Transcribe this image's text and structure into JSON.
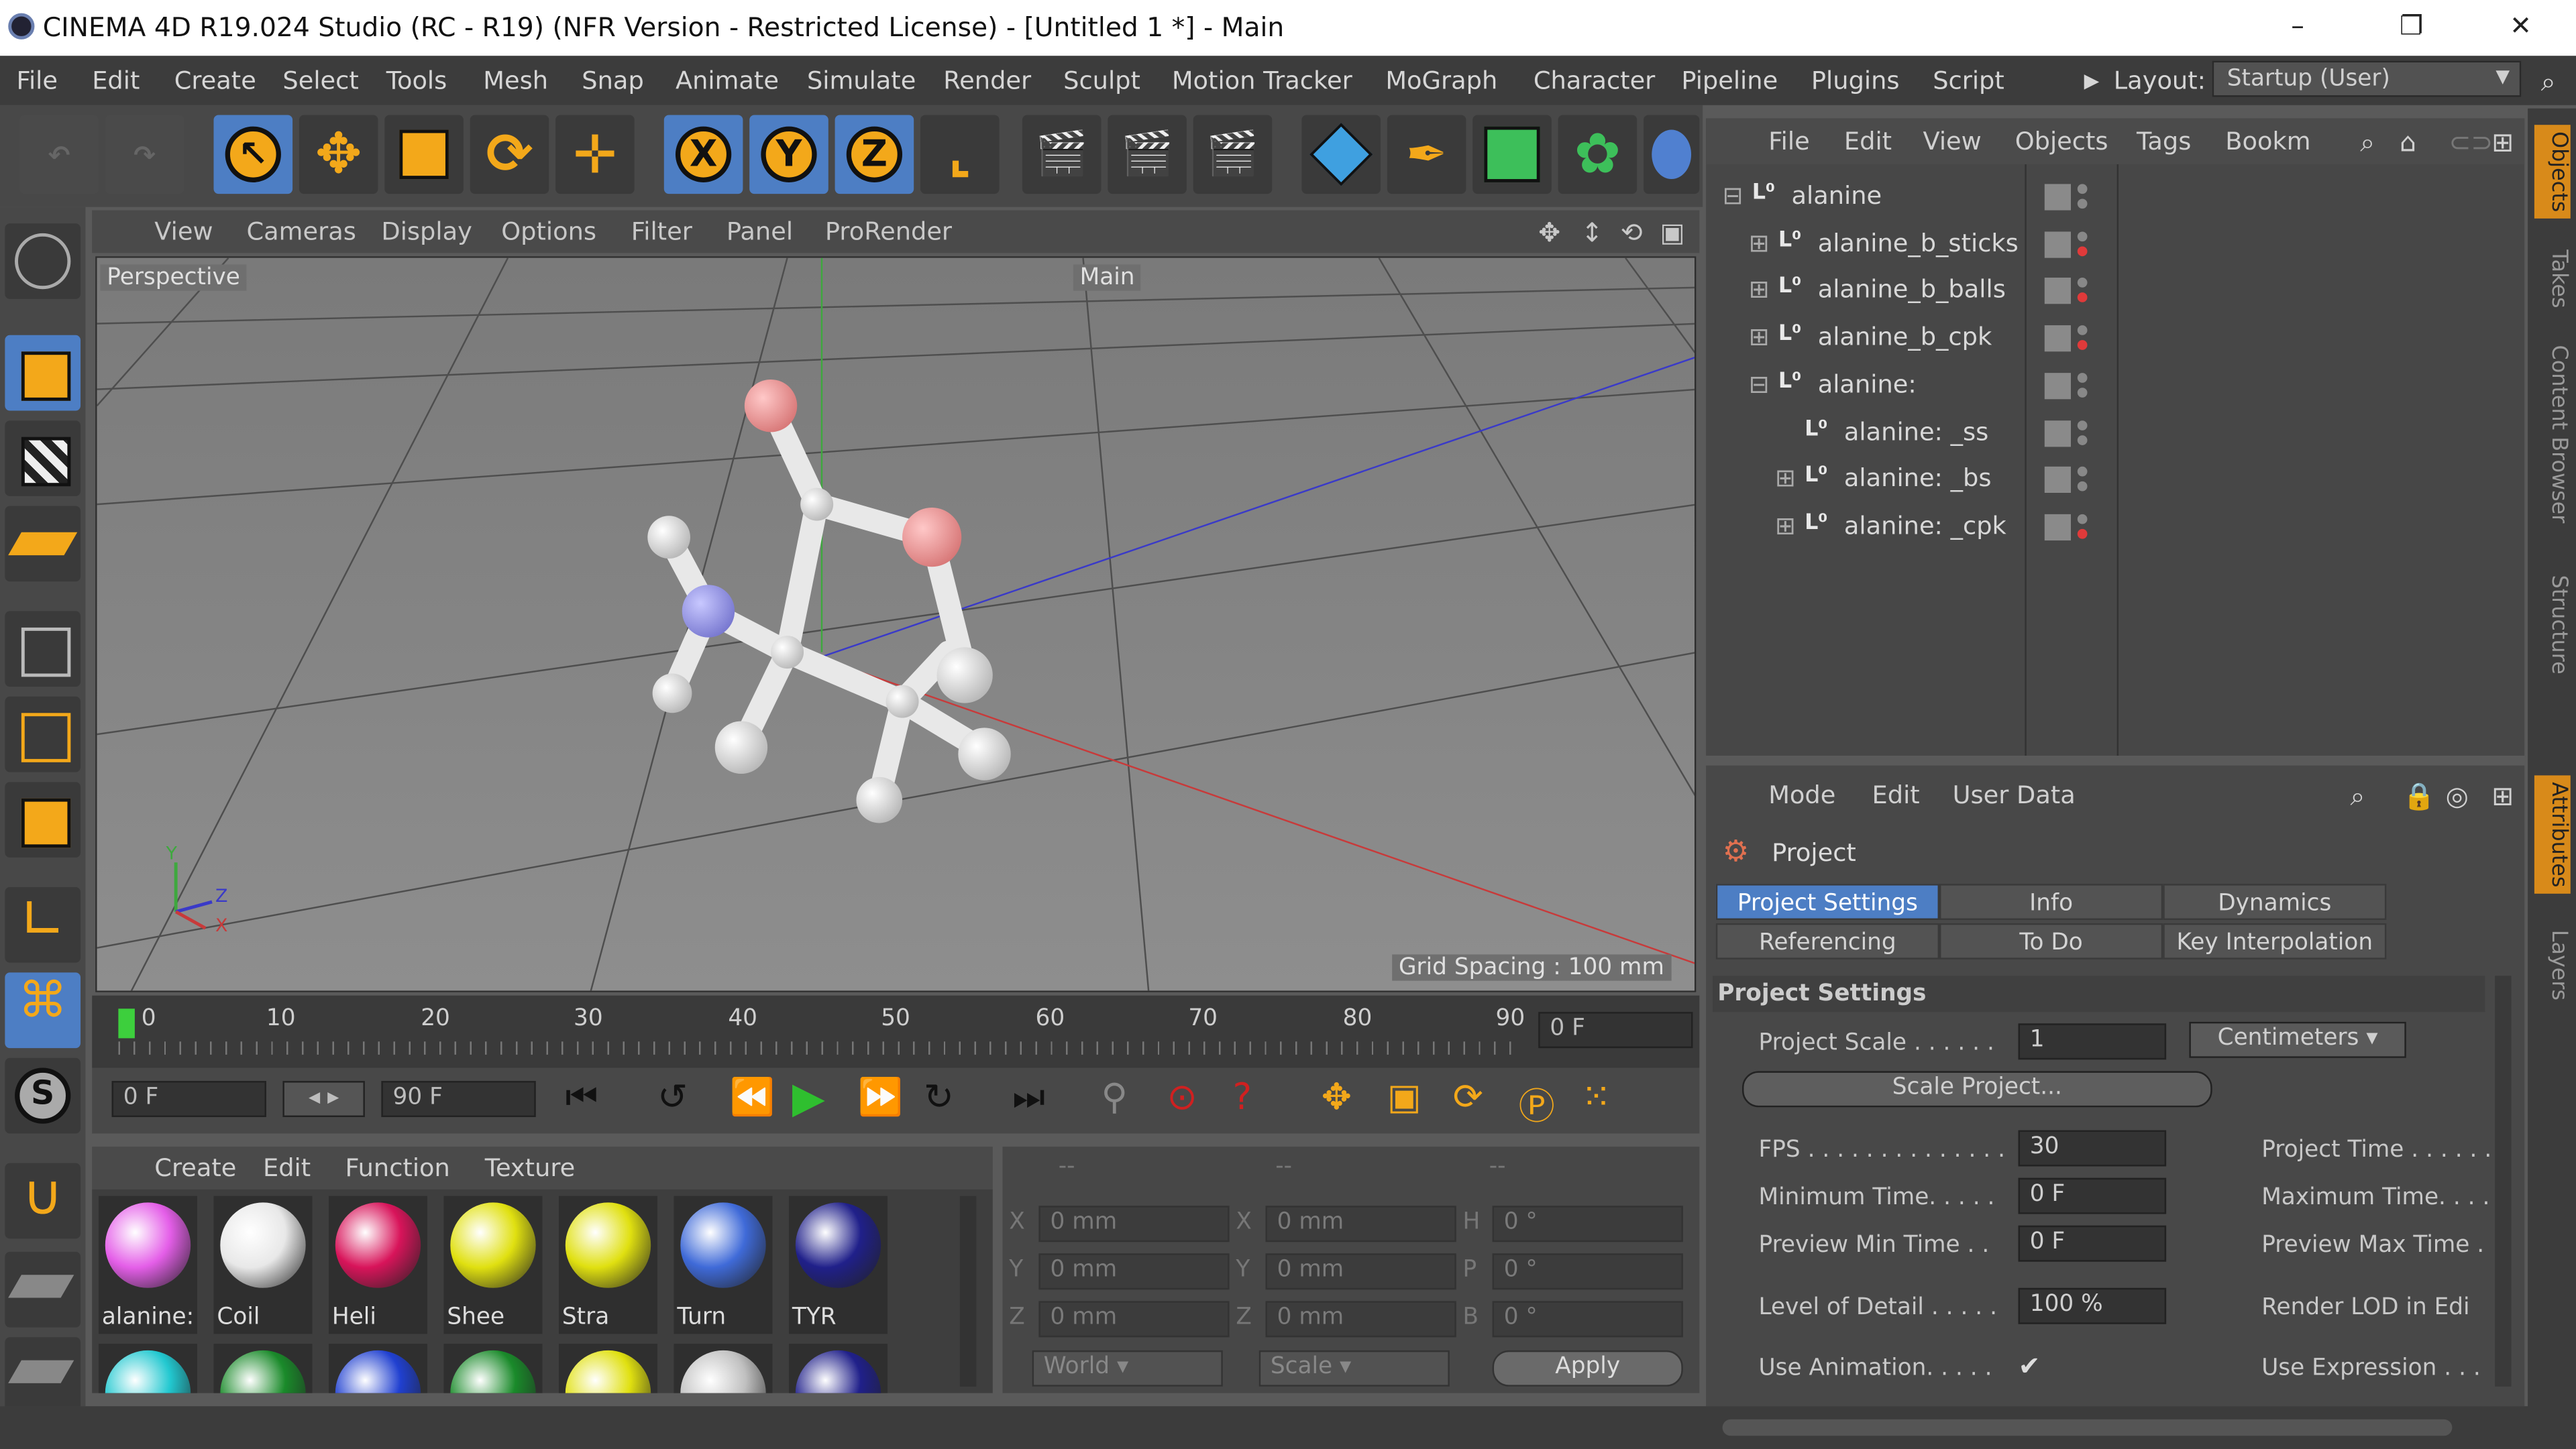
{
  "window": {
    "title": "CINEMA 4D R19.024 Studio (RC - R19) (NFR Version - Restricted License) - [Untitled 1 *] - Main",
    "controls": [
      "–",
      "❐",
      "✕"
    ]
  },
  "menubar": {
    "items": [
      "File",
      "Edit",
      "Create",
      "Select",
      "Tools",
      "Mesh",
      "Snap",
      "Animate",
      "Simulate",
      "Render",
      "Sculpt",
      "Motion Tracker",
      "MoGraph",
      "Character",
      "Pipeline",
      "Plugins",
      "Script"
    ],
    "layout_label": "Layout:",
    "layout_value": "Startup (User)"
  },
  "toolbar": {
    "axis_x": "X",
    "axis_y": "Y",
    "axis_z": "Z"
  },
  "viewport": {
    "menu": [
      "View",
      "Cameras",
      "Display",
      "Options",
      "Filter",
      "Panel",
      "ProRender"
    ],
    "camera_label": "Perspective",
    "main_label": "Main",
    "grid_spacing": "Grid Spacing : 100 mm",
    "axis_y": "Y",
    "axis_z": "Z",
    "axis_x": "X"
  },
  "timeline": {
    "ticks": [
      "0",
      "10",
      "20",
      "30",
      "40",
      "50",
      "60",
      "70",
      "80",
      "90"
    ],
    "current_frame": "0 F",
    "start_frame": "0 F",
    "end_frame": "90 F"
  },
  "material_manager": {
    "menu": [
      "Create",
      "Edit",
      "Function",
      "Texture"
    ],
    "materials": [
      {
        "label": "alanine:",
        "color": "#e45ee8"
      },
      {
        "label": "Coil",
        "color": "#e8e8e8"
      },
      {
        "label": "Heli",
        "color": "#d8145a"
      },
      {
        "label": "Shee",
        "color": "#e0e010"
      },
      {
        "label": "Stra",
        "color": "#e0e010"
      },
      {
        "label": "Turn",
        "color": "#3f6ad8"
      },
      {
        "label": "TYR",
        "color": "#20208a"
      }
    ],
    "second_row_colors": [
      "#22c8d0",
      "#1a8a2a",
      "#2040d0",
      "#1a8a2a",
      "#e0e010",
      "#c0c0c0",
      "#20208a"
    ]
  },
  "coordinates": {
    "headers": [
      "--",
      "--",
      "--"
    ],
    "rows": [
      {
        "l1": "X",
        "v1": "0 mm",
        "l2": "X",
        "v2": "0 mm",
        "l3": "H",
        "v3": "0 °"
      },
      {
        "l1": "Y",
        "v1": "0 mm",
        "l2": "Y",
        "v2": "0 mm",
        "l3": "P",
        "v3": "0 °"
      },
      {
        "l1": "Z",
        "v1": "0 mm",
        "l2": "Z",
        "v2": "0 mm",
        "l3": "B",
        "v3": "0 °"
      }
    ],
    "mode_world": "World",
    "mode_scale": "Scale",
    "apply": "Apply"
  },
  "object_manager": {
    "menu": [
      "File",
      "Edit",
      "View",
      "Objects",
      "Tags",
      "Bookm"
    ],
    "objects": [
      {
        "name": "alanine",
        "expander": "⊟"
      },
      {
        "name": "alanine_b_sticks",
        "expander": "⊞"
      },
      {
        "name": "alanine_b_balls",
        "expander": "⊞"
      },
      {
        "name": "alanine_b_cpk",
        "expander": "⊞"
      },
      {
        "name": "alanine:",
        "expander": "⊟"
      },
      {
        "name": "alanine: _ss",
        "expander": ""
      },
      {
        "name": "alanine: _bs",
        "expander": "⊞"
      },
      {
        "name": "alanine: _cpk",
        "expander": "⊞"
      }
    ]
  },
  "right_tabs": [
    "Objects",
    "Takes",
    "Content Browser",
    "Structure",
    "Attributes",
    "Layers"
  ],
  "attributes": {
    "menu": [
      "Mode",
      "Edit",
      "User Data"
    ],
    "header": "Project",
    "tabs_row1": [
      "Project Settings",
      "Info",
      "Dynamics"
    ],
    "tabs_row2": [
      "Referencing",
      "To Do",
      "Key Interpolation"
    ],
    "section": "Project Settings",
    "project_scale_label": "Project Scale . . . . . .",
    "project_scale_value": "1",
    "project_scale_unit": "Centimeters",
    "scale_project_button": "Scale Project...",
    "fps_label": "FPS . . . . . . . . . . . . . .",
    "fps_value": "30",
    "project_time_label": "Project Time . . . . . .",
    "min_time_label": "Minimum Time. . . . .",
    "min_time_value": "0 F",
    "max_time_label": "Maximum Time. . . . .",
    "preview_min_label": "Preview Min Time . .",
    "preview_min_value": "0 F",
    "preview_max_label": "Preview Max Time .",
    "lod_label": "Level of Detail . . . . .",
    "lod_value": "100 %",
    "render_lod_label": "Render LOD in Edi",
    "use_animation_label": "Use Animation. . . . .",
    "use_animation_check": "✔",
    "use_expression_label": "Use Expression . . ."
  }
}
